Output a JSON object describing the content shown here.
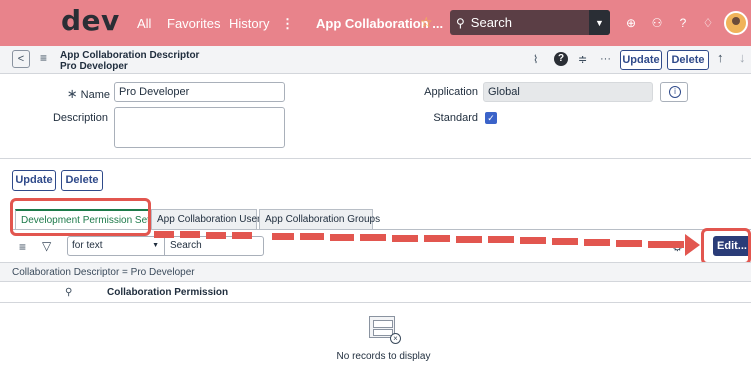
{
  "topnav": {
    "logo": "dev",
    "links": [
      "All",
      "Favorites",
      "History",
      "⋮"
    ],
    "current_tab": "App Collaboration ...",
    "search_placeholder": "Search"
  },
  "form": {
    "title_line1": "App Collaboration Descriptor",
    "title_line2": "Pro Developer",
    "update_label": "Update",
    "delete_label": "Delete",
    "fields": {
      "name_label": "Name",
      "name_value": "Pro Developer",
      "description_label": "Description",
      "description_value": "",
      "application_label": "Application",
      "application_value": "Global",
      "standard_label": "Standard",
      "standard_checked": true
    },
    "bottom_update_label": "Update",
    "bottom_delete_label": "Delete"
  },
  "related": {
    "tabs": [
      {
        "label": "Development Permission Sets",
        "active": true
      },
      {
        "label": "App Collaboration Users",
        "active": false
      },
      {
        "label": "App Collaboration Groups",
        "active": false
      }
    ],
    "filter_field": "for text",
    "search_placeholder": "Search",
    "edit_label": "Edit...",
    "breadcrumb": "Collaboration Descriptor = Pro Developer",
    "column_header": "Collaboration Permission",
    "empty_message": "No records to display"
  },
  "colors": {
    "nav_bg": "#e8838b",
    "accent": "#2f4a8a",
    "annotation": "#e2564f",
    "active_tab": "#1d7a4a"
  }
}
